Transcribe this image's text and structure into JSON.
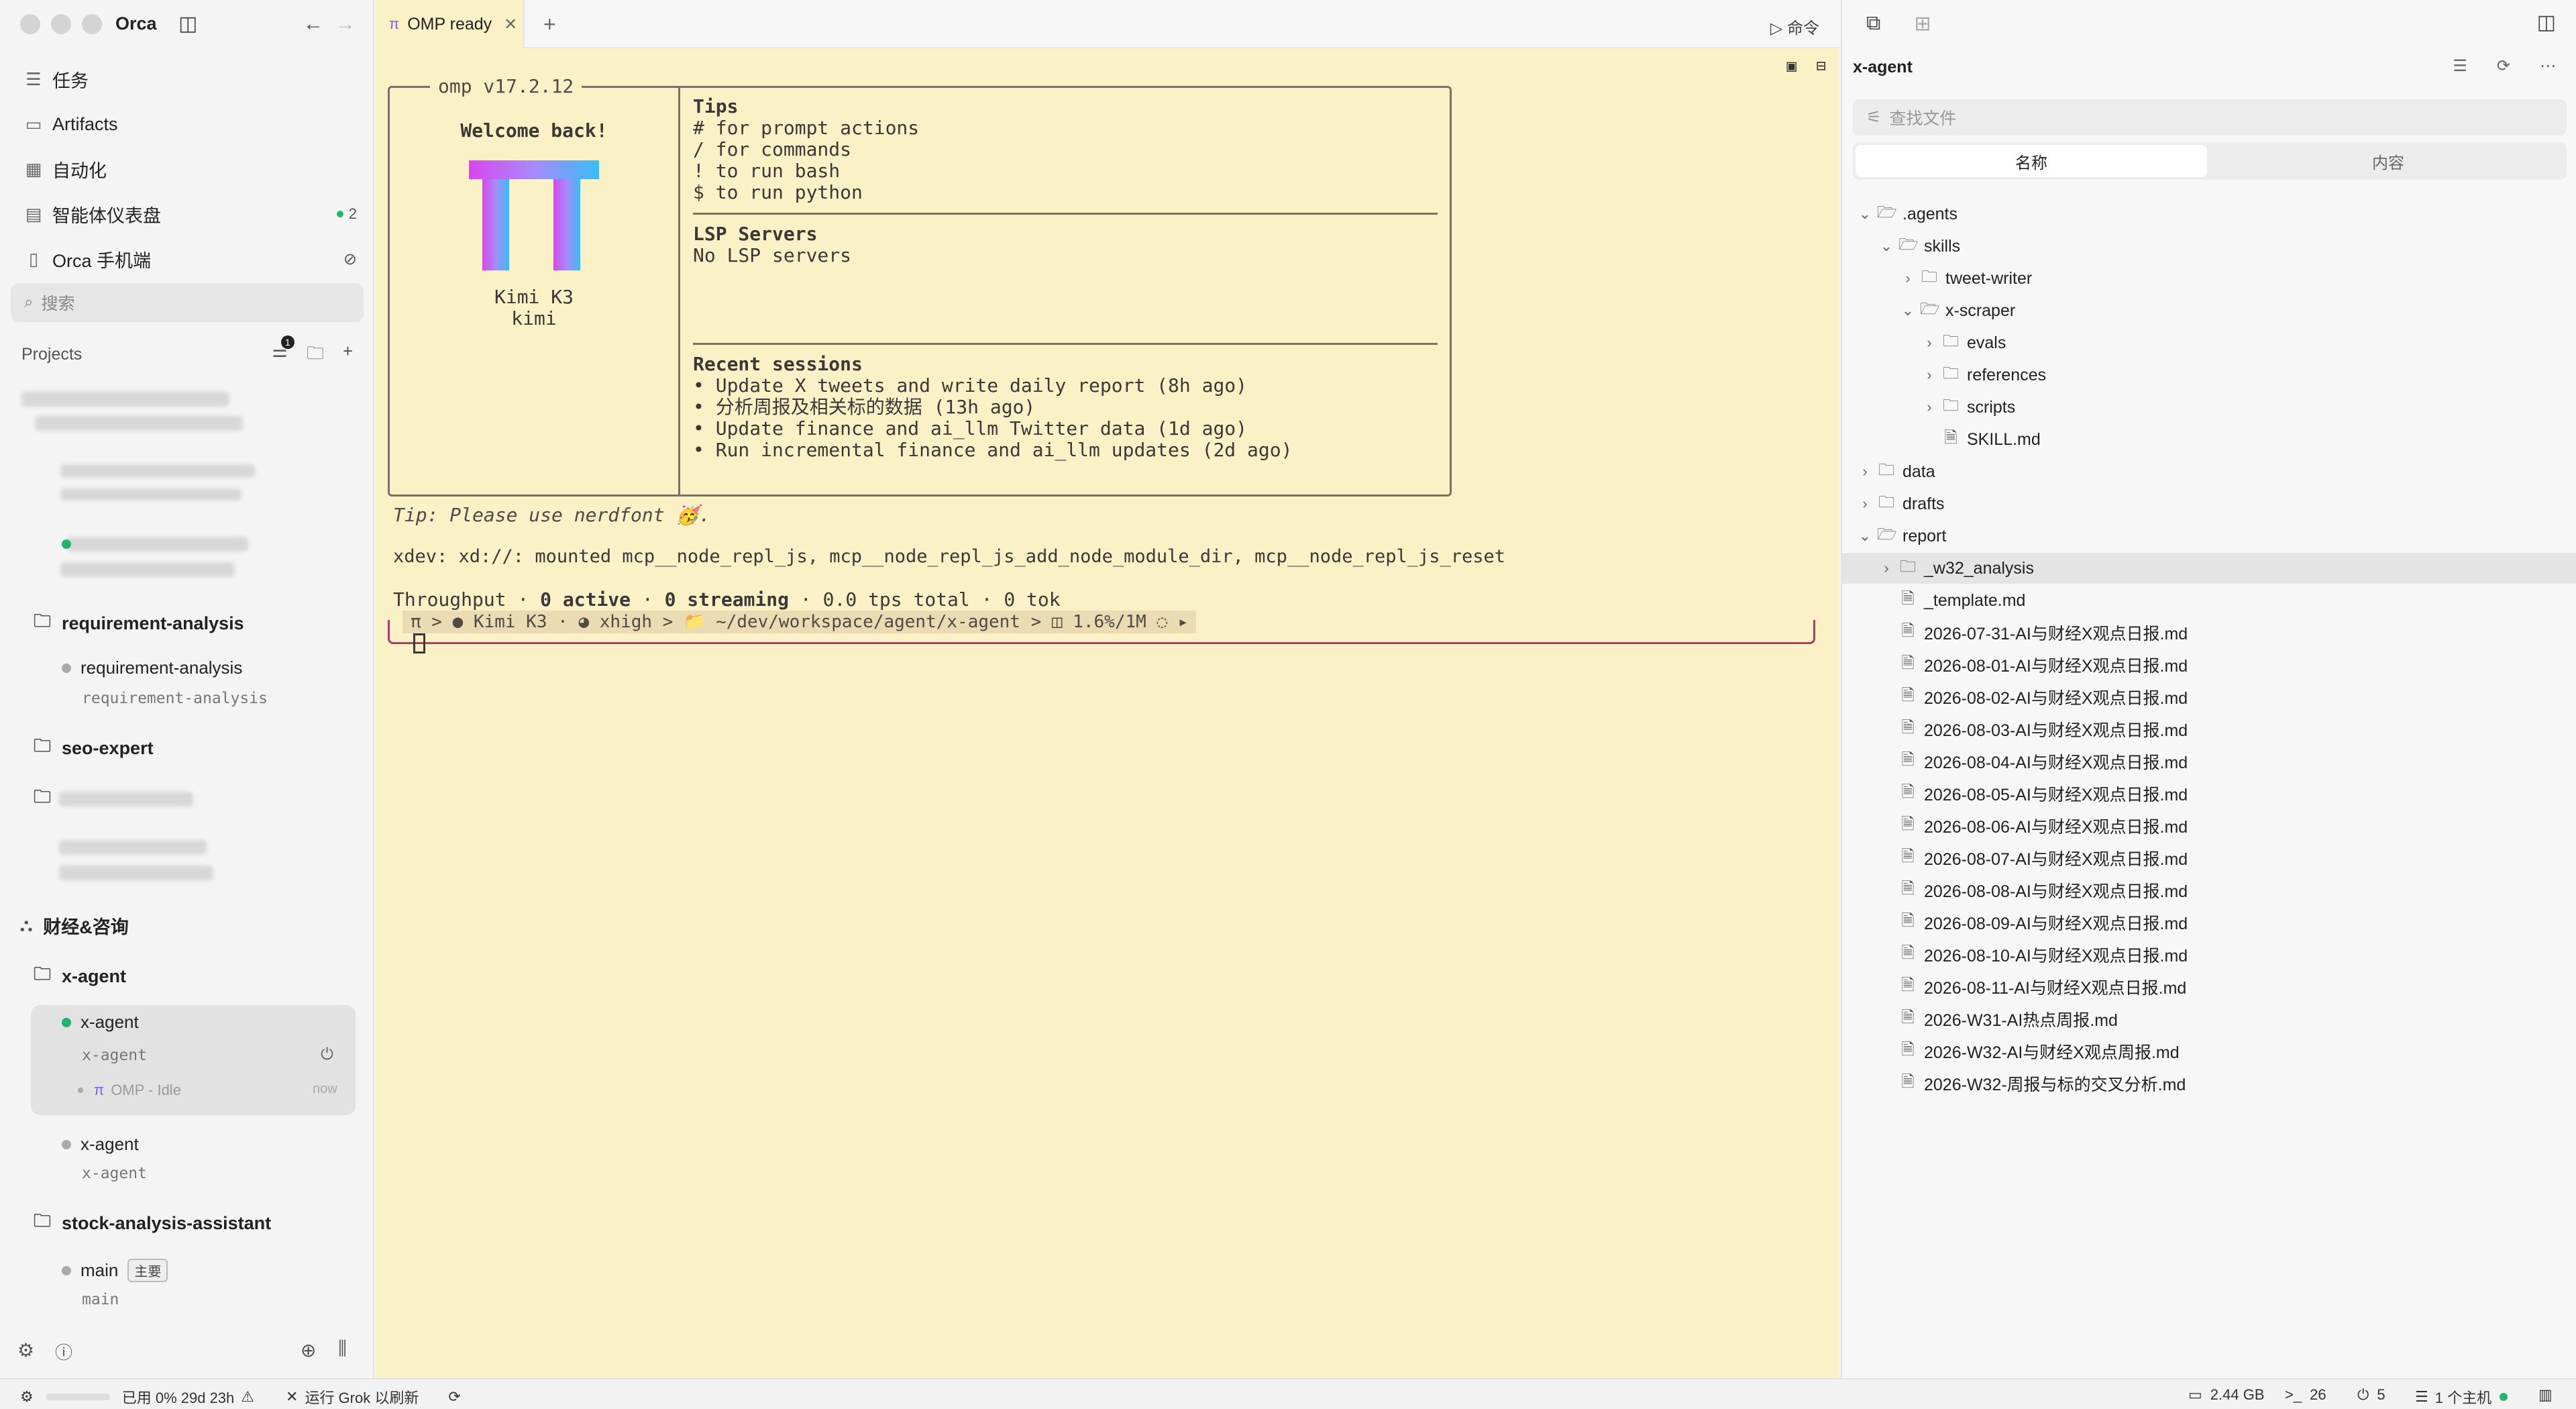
{
  "app": {
    "name": "Orca"
  },
  "sidebar": {
    "nav": [
      {
        "label": "任务",
        "icon": "list-icon"
      },
      {
        "label": "Artifacts",
        "icon": "artifact-icon"
      },
      {
        "label": "自动化",
        "icon": "calendar-icon"
      },
      {
        "label": "智能体仪表盘",
        "icon": "dashboard-icon",
        "badge": "2"
      },
      {
        "label": "Orca 手机端",
        "icon": "phone-icon"
      }
    ],
    "search_placeholder": "搜索",
    "projects_label": "Projects",
    "filter_badge": "1",
    "folders": {
      "requirement_analysis": "requirement-analysis",
      "requirement_analysis_wt": "requirement-analysis",
      "requirement_analysis_wt_sub": "requirement-analysis",
      "seo_expert": "seo-expert",
      "group_finance": "财经&咨询",
      "x_agent": "x-agent",
      "x_agent_wt1": "x-agent",
      "x_agent_wt1_sub": "x-agent",
      "x_agent_session": "OMP - Idle",
      "x_agent_session_time": "now",
      "x_agent_wt2": "x-agent",
      "x_agent_wt2_sub": "x-agent",
      "stock": "stock-analysis-assistant",
      "main": "main",
      "main_tag": "主要",
      "main_sub": "main"
    }
  },
  "tab": {
    "label": "OMP ready"
  },
  "tab_right_label": "命令",
  "terminal": {
    "version": "omp v17.2.12",
    "welcome": "Welcome back!",
    "model": "Kimi K3",
    "model_id": "kimi",
    "tips_title": "Tips",
    "tips": [
      "# for prompt actions",
      "/ for commands",
      "! to run bash",
      "$ to run python"
    ],
    "lsp_title": "LSP Servers",
    "lsp_none": "No LSP servers",
    "recent_title": "Recent sessions",
    "recent": [
      "• Update X tweets and write daily report (8h ago)",
      "• 分析周报及相关标的数据 (13h ago)",
      "• Update finance and ai_llm Twitter data (1d ago)",
      "• Run incremental finance and ai_llm updates (2d ago)"
    ],
    "tip_line": "Tip: Please use nerdfont 🥳.",
    "xdev_line": "xdev: xd://: mounted mcp__node_repl_js, mcp__node_repl_js_add_node_module_dir, mcp__node_repl_js_reset",
    "throughput_prefix": "Throughput · ",
    "active_count": "0 active",
    "sep1": " · ",
    "streaming_count": "0 streaming",
    "throughput_suffix": " · 0.0 tps total · 0 tok",
    "prompt": "π  > ● Kimi K3 · ◕ xhigh > 📁 ~/dev/workspace/agent/x-agent > ◫ 1.6%/1M ◌ ▸"
  },
  "files": {
    "title": "x-agent",
    "search_placeholder": "查找文件",
    "seg_name": "名称",
    "seg_content": "内容",
    "tree": [
      {
        "name": ".agents",
        "type": "folder-open",
        "depth": 0,
        "chev": "⌄"
      },
      {
        "name": "skills",
        "type": "folder-open",
        "depth": 1,
        "chev": "⌄"
      },
      {
        "name": "tweet-writer",
        "type": "folder",
        "depth": 2,
        "chev": "›"
      },
      {
        "name": "x-scraper",
        "type": "folder-open",
        "depth": 2,
        "chev": "⌄"
      },
      {
        "name": "evals",
        "type": "folder",
        "depth": 3,
        "chev": "›"
      },
      {
        "name": "references",
        "type": "folder",
        "depth": 3,
        "chev": "›"
      },
      {
        "name": "scripts",
        "type": "folder",
        "depth": 3,
        "chev": "›"
      },
      {
        "name": "SKILL.md",
        "type": "file",
        "depth": 3,
        "chev": ""
      },
      {
        "name": "data",
        "type": "folder",
        "depth": 0,
        "chev": "›"
      },
      {
        "name": "drafts",
        "type": "folder",
        "depth": 0,
        "chev": "›"
      },
      {
        "name": "report",
        "type": "folder-open",
        "depth": 0,
        "chev": "⌄"
      },
      {
        "name": "_w32_analysis",
        "type": "folder",
        "depth": 1,
        "chev": "›",
        "selected": true
      },
      {
        "name": "_template.md",
        "type": "file",
        "depth": 1,
        "chev": ""
      },
      {
        "name": "2026-07-31-AI与财经X观点日报.md",
        "type": "file",
        "depth": 1,
        "chev": ""
      },
      {
        "name": "2026-08-01-AI与财经X观点日报.md",
        "type": "file",
        "depth": 1,
        "chev": ""
      },
      {
        "name": "2026-08-02-AI与财经X观点日报.md",
        "type": "file",
        "depth": 1,
        "chev": ""
      },
      {
        "name": "2026-08-03-AI与财经X观点日报.md",
        "type": "file",
        "depth": 1,
        "chev": ""
      },
      {
        "name": "2026-08-04-AI与财经X观点日报.md",
        "type": "file",
        "depth": 1,
        "chev": ""
      },
      {
        "name": "2026-08-05-AI与财经X观点日报.md",
        "type": "file",
        "depth": 1,
        "chev": ""
      },
      {
        "name": "2026-08-06-AI与财经X观点日报.md",
        "type": "file",
        "depth": 1,
        "chev": ""
      },
      {
        "name": "2026-08-07-AI与财经X观点日报.md",
        "type": "file",
        "depth": 1,
        "chev": ""
      },
      {
        "name": "2026-08-08-AI与财经X观点日报.md",
        "type": "file",
        "depth": 1,
        "chev": ""
      },
      {
        "name": "2026-08-09-AI与财经X观点日报.md",
        "type": "file",
        "depth": 1,
        "chev": ""
      },
      {
        "name": "2026-08-10-AI与财经X观点日报.md",
        "type": "file",
        "depth": 1,
        "chev": ""
      },
      {
        "name": "2026-08-11-AI与财经X观点日报.md",
        "type": "file",
        "depth": 1,
        "chev": ""
      },
      {
        "name": "2026-W31-AI热点周报.md",
        "type": "file",
        "depth": 1,
        "chev": ""
      },
      {
        "name": "2026-W32-AI与财经X观点周报.md",
        "type": "file",
        "depth": 1,
        "chev": ""
      },
      {
        "name": "2026-W32-周报与标的交叉分析.md",
        "type": "file",
        "depth": 1,
        "chev": ""
      }
    ]
  },
  "status": {
    "usage": "已用 0% 29d 23h",
    "grok": "运行 Grok 以刷新",
    "memory": "2.44 GB",
    "terminals": "26",
    "plugs": "5",
    "hosts": "1 个主机"
  }
}
